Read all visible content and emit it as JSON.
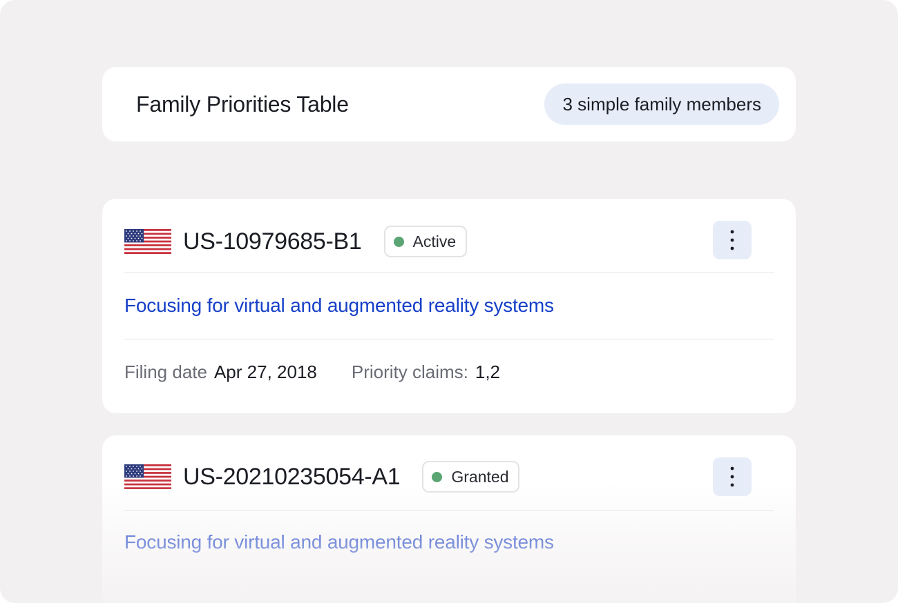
{
  "header": {
    "title": "Family Priorities Table",
    "members_badge": "3 simple family members"
  },
  "patents": [
    {
      "country_icon": "us-flag-icon",
      "number": "US-10979685-B1",
      "status": "Active",
      "status_color": "#5aa573",
      "title": "Focusing for virtual and augmented reality systems",
      "filing_date_label": "Filing date",
      "filing_date": "Apr 27, 2018",
      "priority_claims_label": "Priority claims:",
      "priority_claims": "1,2"
    },
    {
      "country_icon": "us-flag-icon",
      "number": "US-20210235054-A1",
      "status": "Granted",
      "status_color": "#5aa573",
      "title": "Focusing for virtual and augmented reality systems"
    }
  ],
  "colors": {
    "background": "#f3f0f1",
    "accent_pill": "#e6edf8",
    "link": "#1640c8",
    "text": "#1b1d24"
  }
}
